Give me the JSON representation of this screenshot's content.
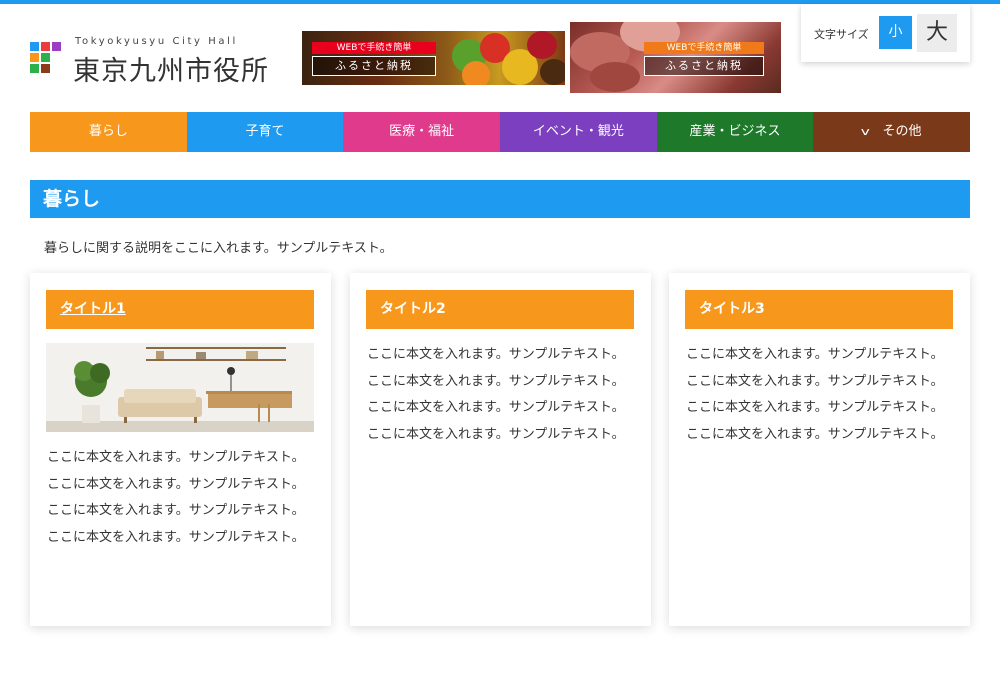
{
  "logo": {
    "sub": "Tokyokyusyu City Hall",
    "title": "東京九州市役所",
    "colors": [
      "#1e9bf0",
      "#e83e3e",
      "#9b3fc0",
      "#f7981d",
      "#2bb14a",
      "#8b3a1a"
    ]
  },
  "banners": [
    {
      "tag": "WEBで手続き簡単",
      "label": "ふるさと納税",
      "tag_color": "#e8001c"
    },
    {
      "tag": "WEBで手続き簡単",
      "label": "ふるさと納税",
      "tag_color": "#f07a1a"
    }
  ],
  "fontsize": {
    "label": "文字サイズ",
    "small": "小",
    "large": "大"
  },
  "nav": [
    {
      "label": "暮らし",
      "color": "#f7981d"
    },
    {
      "label": "子育て",
      "color": "#1e9bf0"
    },
    {
      "label": "医療・福祉",
      "color": "#e03a8c"
    },
    {
      "label": "イベント・観光",
      "color": "#7b3fc0"
    },
    {
      "label": "産業・ビジネス",
      "color": "#1e7a2a"
    },
    {
      "label": "その他",
      "color": "#7a3a1a",
      "icon": "chevron-down-icon"
    }
  ],
  "section": {
    "title": "暮らし",
    "description": "暮らしに関する説明をここに入れます。サンプルテキスト。"
  },
  "cards": [
    {
      "title": "タイトル1",
      "lines": [
        "ここに本文を入れます。サンプルテキスト。",
        "ここに本文を入れます。サンプルテキスト。",
        "ここに本文を入れます。サンプルテキスト。",
        "ここに本文を入れます。サンプルテキスト。"
      ]
    },
    {
      "title": "タイトル2",
      "lines": [
        "ここに本文を入れます。サンプルテキスト。",
        "ここに本文を入れます。サンプルテキスト。",
        "ここに本文を入れます。サンプルテキスト。",
        "ここに本文を入れます。サンプルテキスト。"
      ]
    },
    {
      "title": "タイトル3",
      "lines": [
        "ここに本文を入れます。サンプルテキスト。",
        "ここに本文を入れます。サンプルテキスト。",
        "ここに本文を入れます。サンプルテキスト。",
        "ここに本文を入れます。サンプルテキスト。"
      ]
    }
  ]
}
